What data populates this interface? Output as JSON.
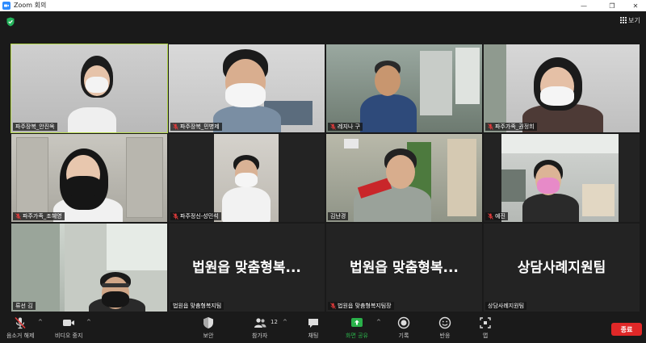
{
  "window": {
    "title": "Zoom 회의",
    "controls": {
      "minimize": "—",
      "restore": "❐",
      "close": "✕"
    }
  },
  "top": {
    "view_label": "보기"
  },
  "colors": {
    "active_speaker": "#b6d94c",
    "end_button": "#e02828",
    "share_green": "#2ab14a"
  },
  "participants": [
    {
      "name": "파주장복_안진옥",
      "muted": false,
      "active": true
    },
    {
      "name": "파주장복_민병제",
      "muted": true,
      "active": false
    },
    {
      "name": "레지나 구",
      "muted": true,
      "active": false
    },
    {
      "name": "파주가족_권정희",
      "muted": true,
      "active": false
    },
    {
      "name": "파주가족_조혜영",
      "muted": true,
      "active": false
    },
    {
      "name": "파주정신-성민석",
      "muted": true,
      "active": false
    },
    {
      "name": "김난경",
      "muted": false,
      "active": false
    },
    {
      "name": "예진",
      "muted": true,
      "active": false
    },
    {
      "name": "류선 김",
      "muted": false,
      "active": false
    },
    {
      "name": "법원읍 맞춤형복지팀",
      "muted": false,
      "active": false,
      "big": "법원읍 맞춤형복..."
    },
    {
      "name": "법원읍 맞춤형복지팀장",
      "muted": true,
      "active": false,
      "big": "법원읍 맞춤형복..."
    },
    {
      "name": "상담사례지원팀",
      "muted": false,
      "active": false,
      "big": "상담사례지원팀"
    }
  ],
  "toolbar": {
    "audio": "음소거 해제",
    "video": "비디오 중지",
    "security": "보안",
    "participants": "참가자",
    "participants_count": "12",
    "chat": "채팅",
    "share": "화면 공유",
    "record": "기록",
    "reactions": "반응",
    "apps": "앱",
    "end": "종료"
  }
}
